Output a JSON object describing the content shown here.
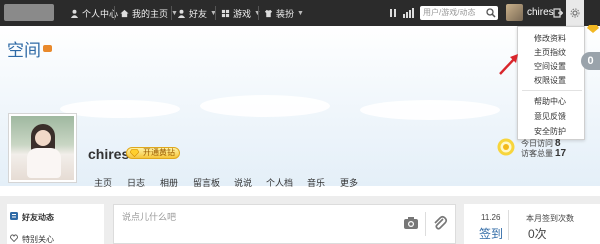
{
  "nav": {
    "items": [
      {
        "label": "个人中心",
        "icon": "person-icon"
      },
      {
        "label": "我的主页",
        "icon": "home-icon"
      },
      {
        "label": "好友",
        "icon": "friends-icon"
      },
      {
        "label": "游戏",
        "icon": "game-icon"
      },
      {
        "label": "装扮",
        "icon": "shirt-icon"
      }
    ],
    "search_placeholder": "用户/游戏/动态",
    "username": "chires"
  },
  "page": {
    "title": "空间"
  },
  "dropdown": {
    "group1": [
      "修改资料",
      "主页指纹",
      "空间设置",
      "权限设置"
    ],
    "group2": [
      "帮助中心",
      "意见反馈",
      "安全防护"
    ]
  },
  "badge_count": "0",
  "profile": {
    "name": "chires",
    "vip_label": "开通黄钻"
  },
  "menu": [
    "主页",
    "日志",
    "相册",
    "留言板",
    "说说",
    "个人档",
    "音乐",
    "更多"
  ],
  "stats": {
    "row1_label": "今日访问",
    "row1_value": "8",
    "row2_label": "访客总量",
    "row2_value": "17"
  },
  "left_panel": [
    {
      "label": "好友动态",
      "icon": "feed-icon"
    },
    {
      "label": "特别关心",
      "icon": "heart-icon"
    }
  ],
  "post": {
    "placeholder": "说点儿什么吧"
  },
  "signin": {
    "date": "11.26",
    "button": "签到",
    "month_label": "本月签到次数",
    "month_count": "0次"
  },
  "colors": {
    "nav_bg": "#2b2b2b",
    "accent": "#2f6aa6",
    "vip": "#f6c53a"
  }
}
